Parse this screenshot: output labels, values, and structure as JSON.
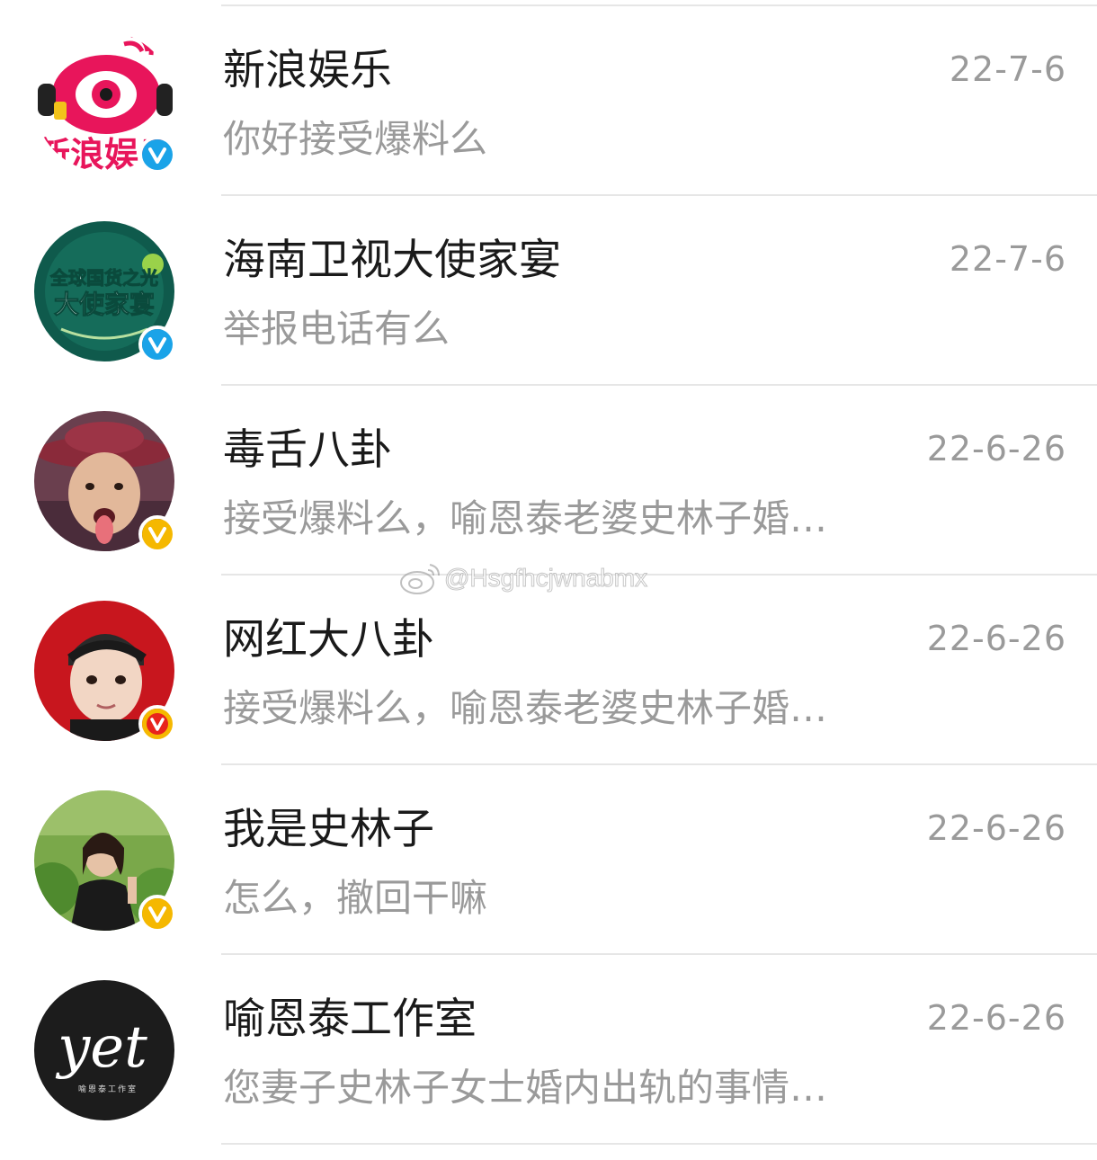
{
  "conversations": [
    {
      "name": "新浪娱乐",
      "preview": "你好接受爆料么",
      "date": "22-7-6",
      "badge_color": "#1aa3e8",
      "avatar": "sina-entertainment-logo"
    },
    {
      "name": "海南卫视大使家宴",
      "preview": "举报电话有么",
      "date": "22-7-6",
      "badge_color": "#1aa3e8",
      "avatar": "ambassador-banquet-logo"
    },
    {
      "name": "毒舌八卦",
      "preview": "接受爆料么，喻恩泰老婆史林子婚…",
      "date": "22-6-26",
      "badge_color": "#f5b800",
      "avatar": "man-with-hat-photo"
    },
    {
      "name": "网红大八卦",
      "preview": "接受爆料么，喻恩泰老婆史林子婚…",
      "date": "22-6-26",
      "badge_color": "#e8231c",
      "avatar": "cartoon-boy-illustration"
    },
    {
      "name": "我是史林子",
      "preview": "怎么，撤回干嘛",
      "date": "22-6-26",
      "badge_color": "#f5b800",
      "avatar": "woman-outdoor-photo"
    },
    {
      "name": "喻恩泰工作室",
      "preview": "您妻子史林子女士婚内出轨的事情…",
      "date": "22-6-26",
      "badge_color": "#1a1a1a",
      "avatar": "yet-studio-logo"
    }
  ],
  "avatar_text": {
    "sina": "新浪娱乐",
    "banquet_line1": "全球国货之光",
    "banquet_line2": "大使家宴",
    "yet_logo": "yet",
    "yet_sub": "喻恩泰工作室"
  },
  "watermark": {
    "text": "@Hsgfhcjwnabmx",
    "icon": "weibo-icon"
  }
}
